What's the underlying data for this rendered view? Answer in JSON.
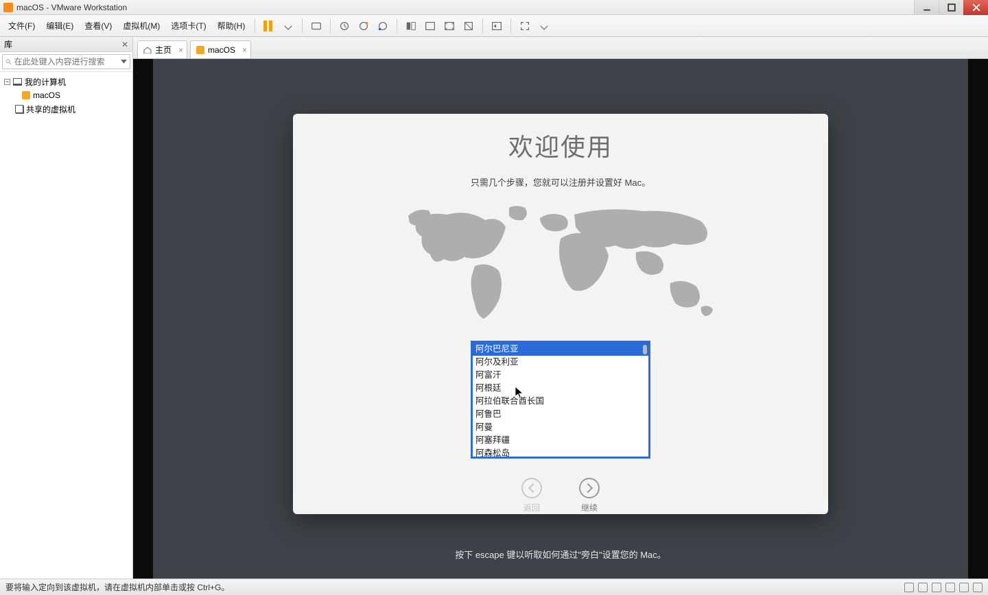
{
  "titlebar": {
    "title": "macOS - VMware Workstation"
  },
  "menu": {
    "file": "文件(F)",
    "edit": "编辑(E)",
    "view": "查看(V)",
    "vm": "虚拟机(M)",
    "tabs": "选项卡(T)",
    "help": "帮助(H)"
  },
  "library": {
    "title": "库",
    "search_placeholder": "在此处键入内容进行搜索",
    "my_computers": "我的计算机",
    "macos": "macOS",
    "shared_vms": "共享的虚拟机"
  },
  "tabs": {
    "home": "主页",
    "macos": "macOS"
  },
  "welcome": {
    "title": "欢迎使用",
    "subtitle": "只需几个步骤，您就可以注册并设置好 Mac。",
    "countries": [
      "阿尔巴尼亚",
      "阿尔及利亚",
      "阿富汗",
      "阿根廷",
      "阿拉伯联合酋长国",
      "阿鲁巴",
      "阿曼",
      "阿塞拜疆",
      "阿森松岛"
    ],
    "back": "返回",
    "continue": "继续",
    "escape_hint": "按下 escape 键以听取如何通过\"旁白\"设置您的 Mac。"
  },
  "statusbar": {
    "hint": "要将输入定向到该虚拟机，请在虚拟机内部单击或按 Ctrl+G。"
  }
}
